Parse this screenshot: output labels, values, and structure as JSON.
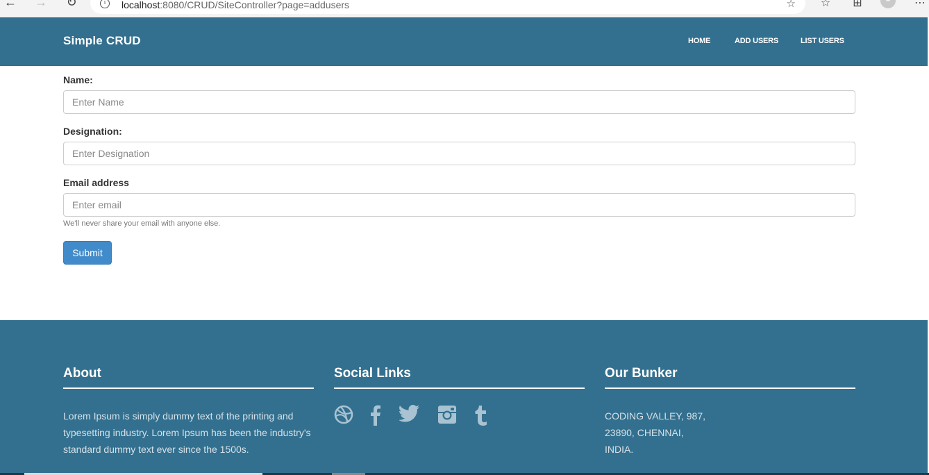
{
  "browser": {
    "url_host": "localhost",
    "url_rest": ":8080/CRUD/SiteController?page=addusers"
  },
  "header": {
    "brand": "Simple CRUD",
    "nav": [
      "HOME",
      "ADD USERS",
      "LIST USERS"
    ]
  },
  "form": {
    "name_label": "Name:",
    "name_placeholder": "Enter Name",
    "designation_label": "Designation:",
    "designation_placeholder": "Enter Designation",
    "email_label": "Email address",
    "email_placeholder": "Enter email",
    "email_help": "We'll never share your email with anyone else.",
    "submit_label": "Submit"
  },
  "footer": {
    "about_title": "About",
    "about_text": "Lorem Ipsum is simply dummy text of the printing and typesetting industry. Lorem Ipsum has been the industry's standard dummy text ever since the 1500s.",
    "social_title": "Social Links",
    "social_icons": [
      "dribbble-icon",
      "facebook-icon",
      "twitter-icon",
      "instagram-icon",
      "tumblr-icon"
    ],
    "bunker_title": "Our Bunker",
    "address_lines": [
      "CODING VALLEY, 987,",
      "23890, CHENNAI,",
      "INDIA."
    ]
  },
  "colors": {
    "header_bg": "#33708f",
    "footer_bg": "#33708f",
    "button_bg": "#428bca"
  }
}
